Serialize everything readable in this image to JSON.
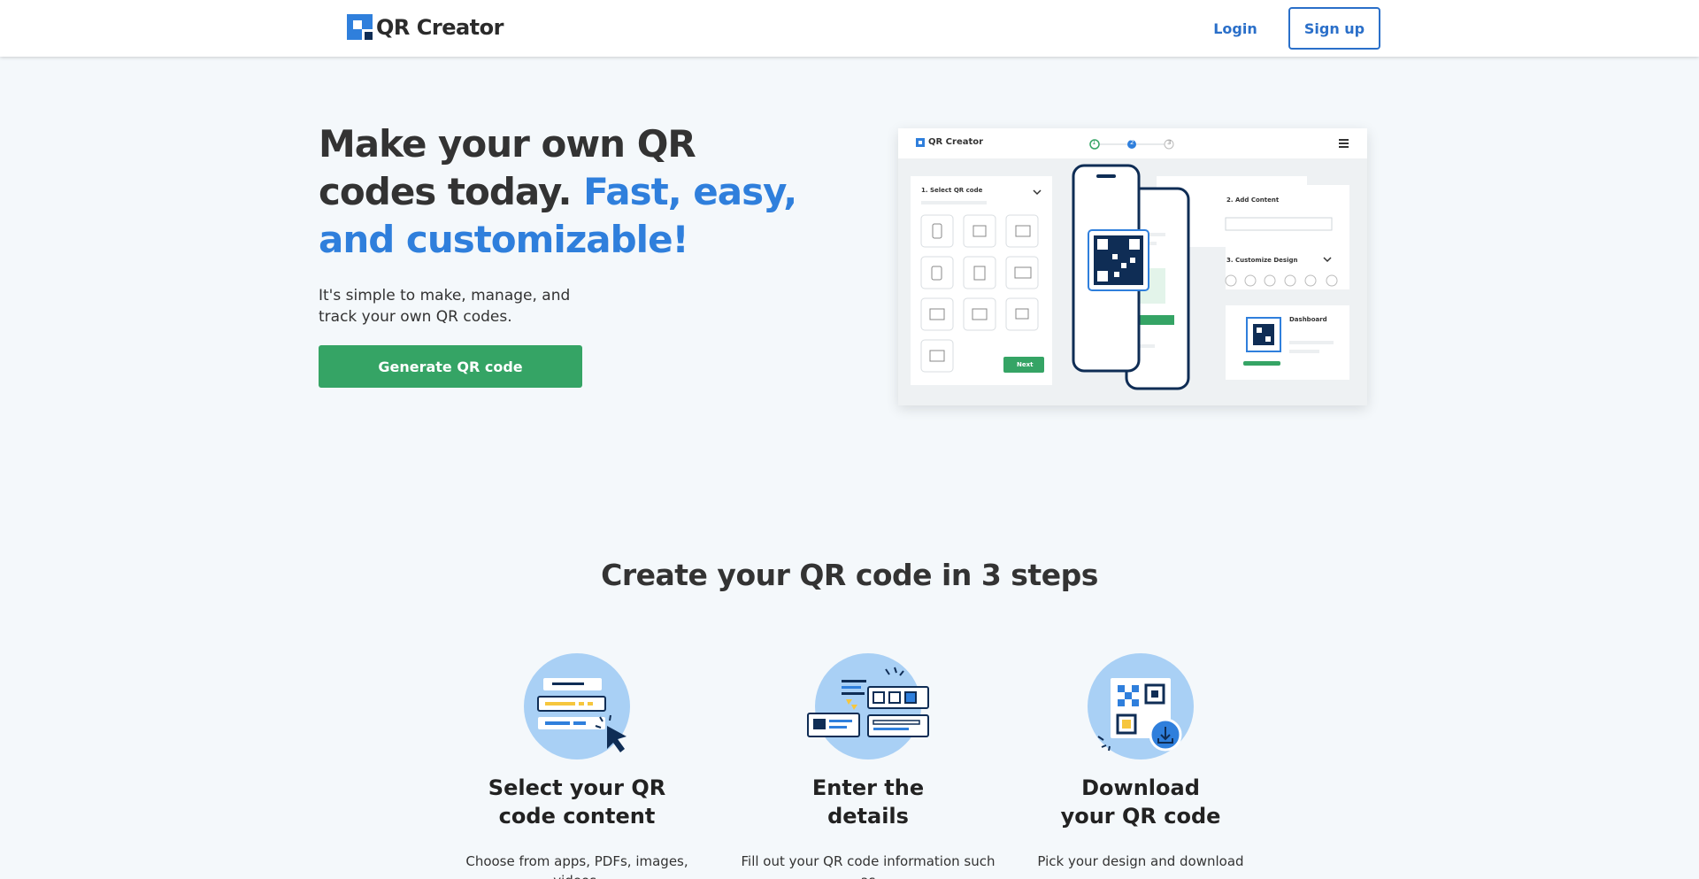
{
  "header": {
    "logo_text": "QR Creator",
    "login_label": "Login",
    "signup_label": "Sign up"
  },
  "hero": {
    "title_main": "Make your own QR codes today.",
    "title_accent": "Fast, easy, and customizable!",
    "subtitle": "It's simple to make, manage, and track your own QR codes.",
    "cta_label": "Generate QR code"
  },
  "mockup": {
    "logo_text": "QR Creator",
    "steps": [
      "1",
      "2",
      "3"
    ],
    "panel1_title": "1. Select QR code",
    "next_label": "Next",
    "panel2_title": "2. Add Content",
    "panel3_title": "3. Customize Design",
    "dashboard_label": "Dashboard"
  },
  "steps_section": {
    "title": "Create your QR code in 3 steps",
    "items": [
      {
        "heading_line1": "Select your QR",
        "heading_line2": "code content",
        "desc": "Choose from apps, PDFs, images, videos,"
      },
      {
        "heading_line1": "Enter the",
        "heading_line2": "details",
        "desc": "Fill out your QR code information such as"
      },
      {
        "heading_line1": "Download",
        "heading_line2": "your QR code",
        "desc": "Pick your design and download"
      }
    ]
  },
  "colors": {
    "accent_blue": "#2f7fdc",
    "cta_green": "#35a465",
    "navy": "#0f2d55",
    "light_blue": "#a9d0f5",
    "yellow": "#f6c63d"
  }
}
